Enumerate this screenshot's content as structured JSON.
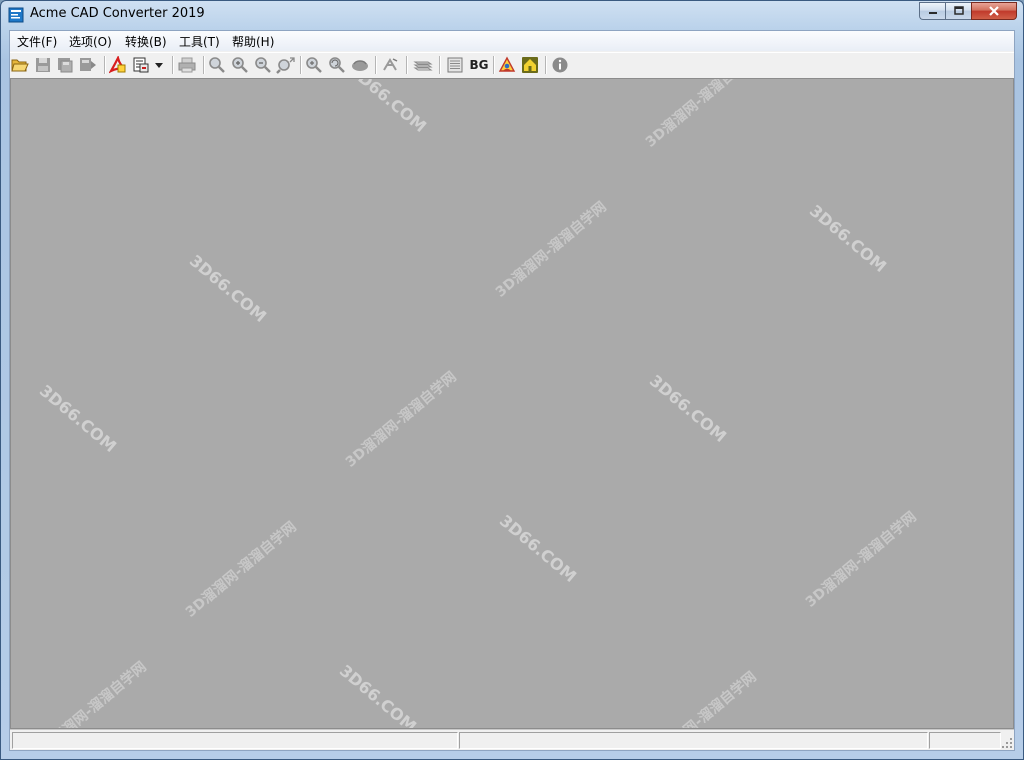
{
  "window": {
    "title": "Acme CAD Converter 2019",
    "icon": "app-document-icon",
    "buttons": [
      "minimize-icon",
      "maximize-icon",
      "close-icon"
    ]
  },
  "menubar": {
    "items": [
      {
        "label": "文件(F)"
      },
      {
        "label": "选项(O)"
      },
      {
        "label": "转换(B)"
      },
      {
        "label": "工具(T)"
      },
      {
        "label": "帮助(H)"
      }
    ]
  },
  "toolbar": {
    "buttons": [
      {
        "icon": "open-folder-icon"
      },
      {
        "icon": "save-icon"
      },
      {
        "icon": "save-as-icon"
      },
      {
        "icon": "batch-save-icon"
      },
      {
        "icon": "export-pdf-icon"
      },
      {
        "icon": "convert-document-icon"
      },
      {
        "icon": "dropdown-arrow-icon"
      },
      {
        "icon": "print-icon"
      },
      {
        "icon": "zoom-window-icon"
      },
      {
        "icon": "zoom-in-icon"
      },
      {
        "icon": "zoom-out-icon"
      },
      {
        "icon": "zoom-extents-icon"
      },
      {
        "icon": "zoom-realtime-icon"
      },
      {
        "icon": "zoom-previous-icon"
      },
      {
        "icon": "pan-icon"
      },
      {
        "icon": "layers-icon"
      },
      {
        "icon": "sheets-icon"
      },
      {
        "icon": "grid-icon"
      },
      {
        "icon": "background-icon"
      },
      {
        "icon": "help-book-icon"
      },
      {
        "icon": "home-icon"
      },
      {
        "icon": "info-icon"
      }
    ],
    "bg_label": "BG"
  },
  "colors": {
    "canvas_background": "#aaaaaa",
    "title_bar": "#b9d1ea",
    "close_button": "#c0392b"
  },
  "watermark": {
    "site": "3D66.COM",
    "text": "3D溜溜网-溜溜自学网"
  },
  "statusbar": {
    "panes": [
      "",
      "",
      ""
    ]
  }
}
